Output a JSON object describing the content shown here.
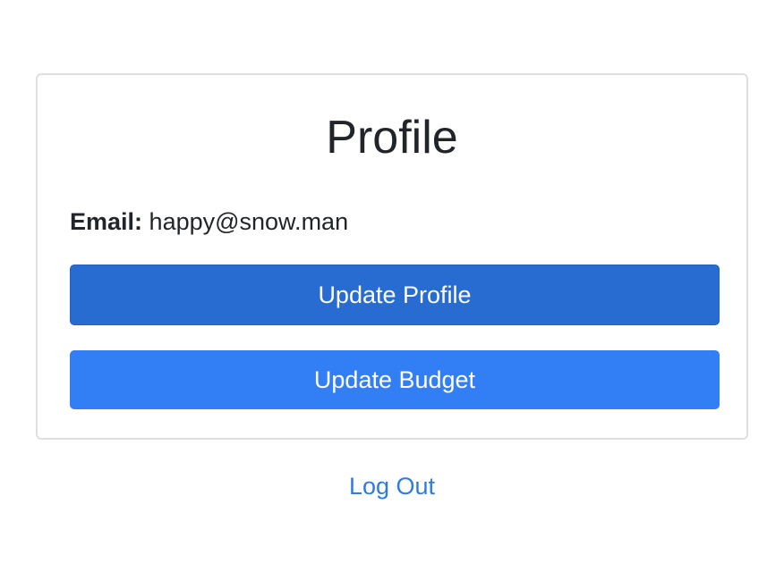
{
  "profile_card": {
    "title": "Profile",
    "email_label": "Email:",
    "email_value": "happy@snow.man",
    "update_profile_label": "Update Profile",
    "update_budget_label": "Update Budget"
  },
  "logout": {
    "label": "Log Out"
  },
  "colors": {
    "primary_active": "#286bd1",
    "primary": "#317ef5",
    "link": "#2f7be0",
    "card_border": "#dfdfdf"
  }
}
